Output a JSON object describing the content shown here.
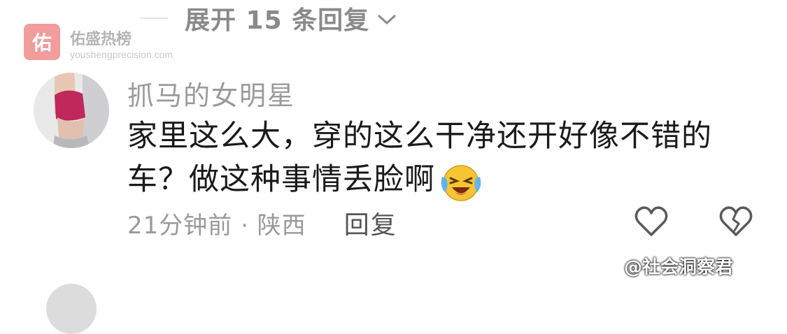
{
  "thread": {
    "expand_label": "展开 15 条回复"
  },
  "watermark": {
    "logo_char": "佑",
    "name": "佑盛热榜",
    "url": "youshengprecision.com"
  },
  "comment": {
    "username": "抓马的女明星",
    "text": "家里这么大，穿的这么干净还开好像不错的车？做这种事情丢脸啊",
    "emoji": "laughing-crying-emoji",
    "time_location": "21分钟前 · 陕西",
    "reply_label": "回复"
  },
  "source_tag": "@社会洞察君",
  "icons": {
    "expand": "chevron-down-icon",
    "like": "heart-icon",
    "dislike": "broken-heart-icon"
  },
  "colors": {
    "meta_gray": "#9a9a9a",
    "text_black": "#1a1a1a",
    "logo_red": "#f08b8b"
  }
}
